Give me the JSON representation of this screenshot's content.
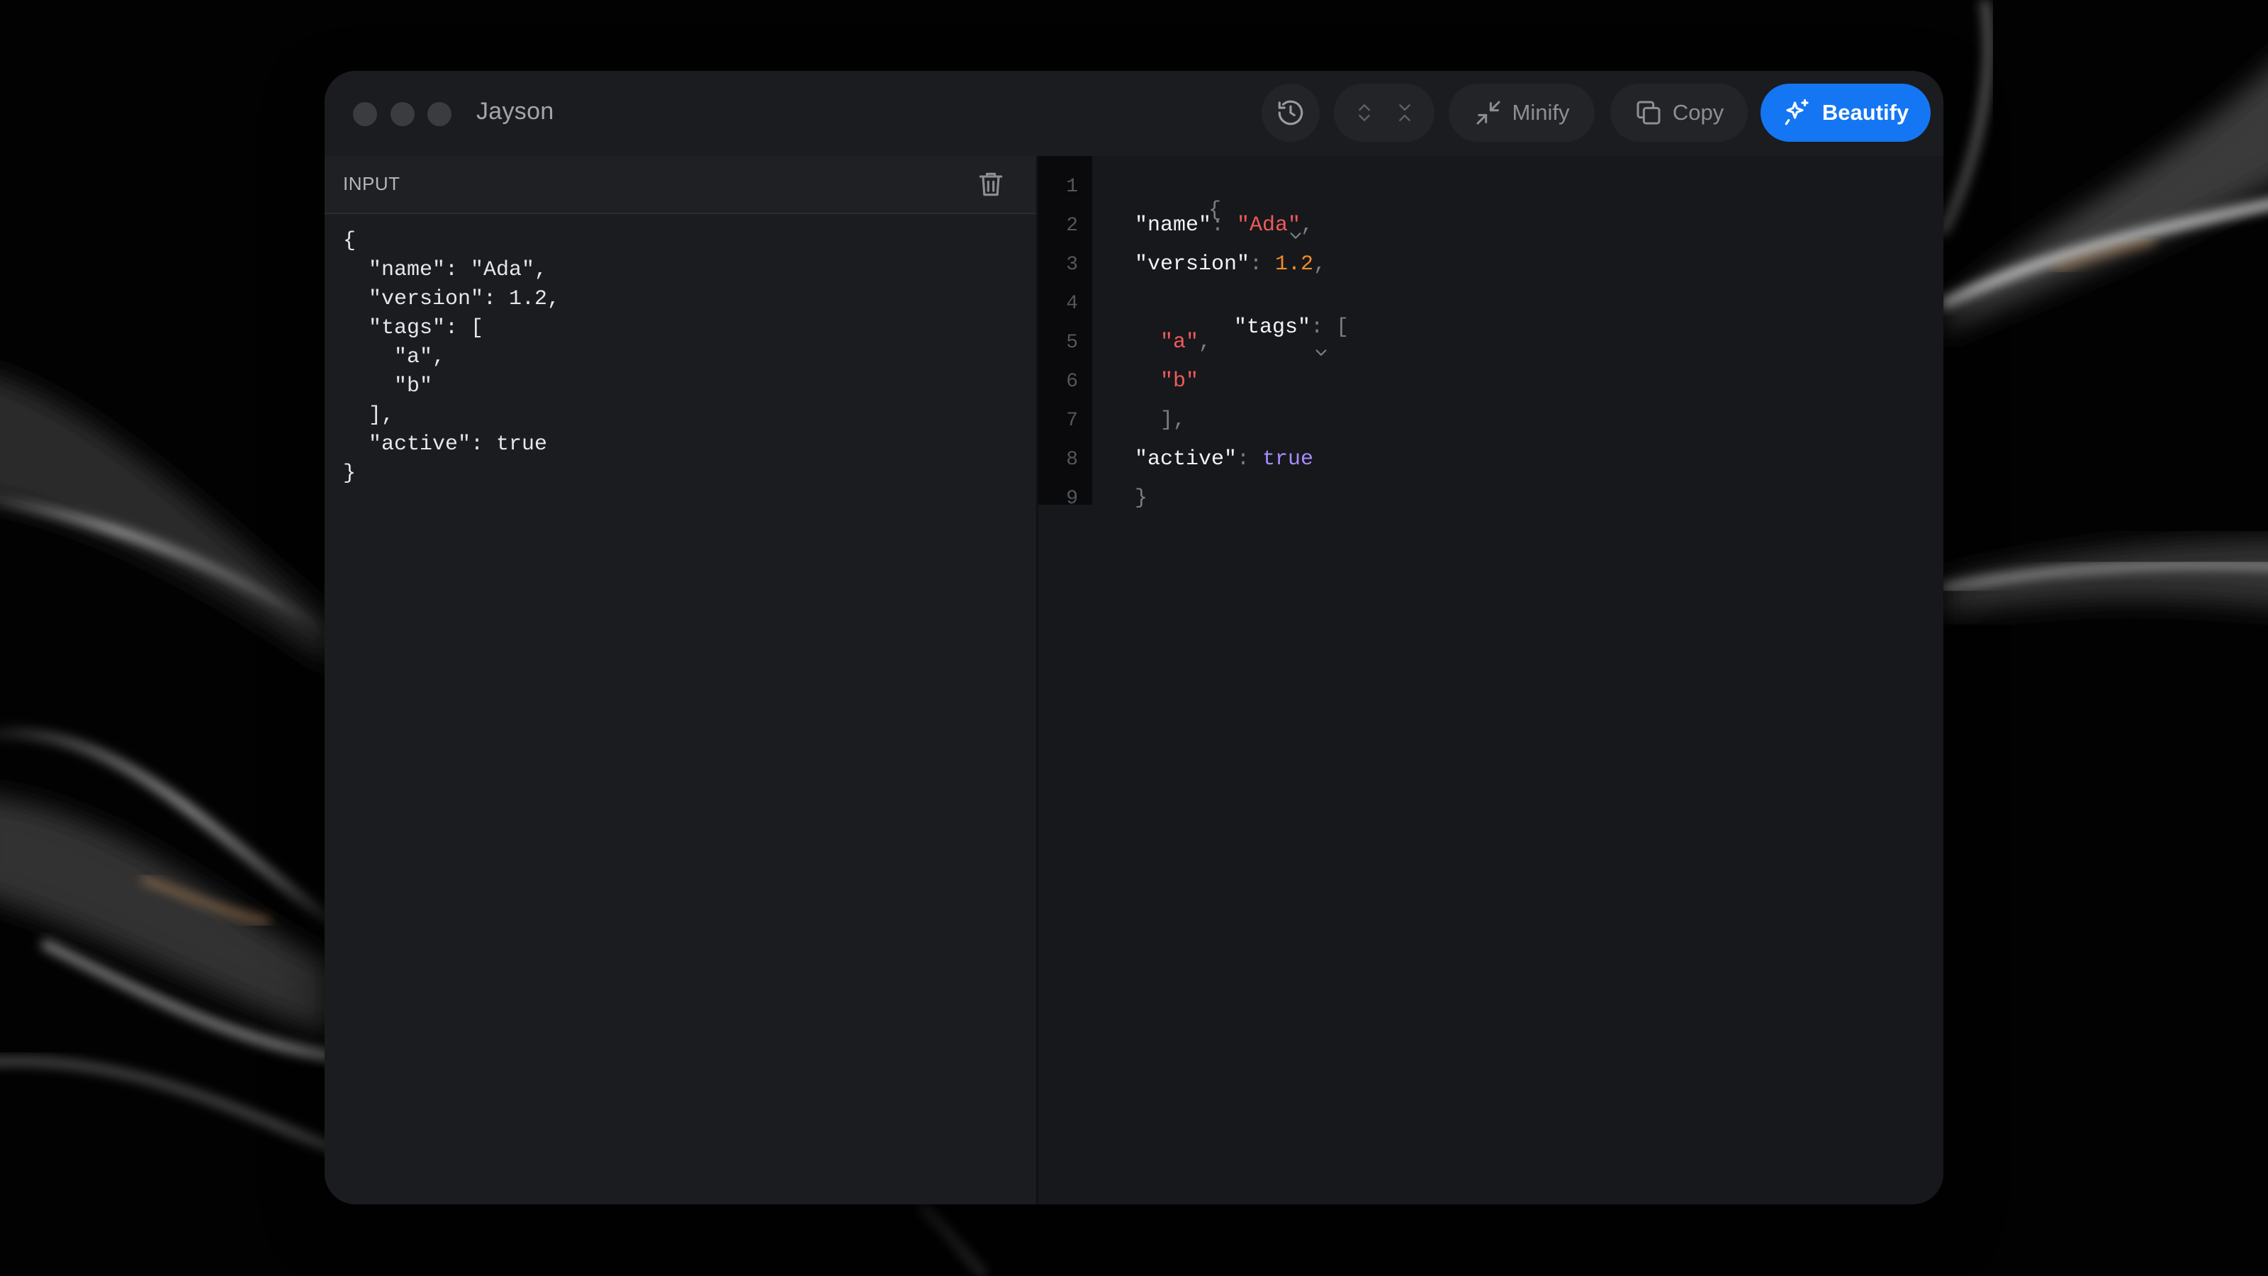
{
  "app": {
    "title": "Jayson"
  },
  "toolbar": {
    "history_icon": "history-icon",
    "expand_icon": "chevrons-expand-icon",
    "collapse_icon": "chevrons-collapse-icon",
    "minify_label": "Minify",
    "copy_label": "Copy",
    "beautify_label": "Beautify",
    "accent_color": "#1476f2"
  },
  "input": {
    "label": "INPUT",
    "text": "{\n  \"name\": \"Ada\",\n  \"version\": 1.2,\n  \"tags\": [\n    \"a\",\n    \"b\"\n  ],\n  \"active\": true\n}"
  },
  "output": {
    "line_numbers": [
      "1",
      "2",
      "3",
      "4",
      "5",
      "6",
      "7",
      "8",
      "9"
    ],
    "lines": {
      "l1": {
        "open": "{"
      },
      "l2": {
        "key": "\"name\"",
        "colon": ": ",
        "value": "\"Ada\"",
        "comma": ","
      },
      "l3": {
        "key": "\"version\"",
        "colon": ": ",
        "value": "1.2",
        "comma": ","
      },
      "l4": {
        "key": "\"tags\"",
        "colon": ": ",
        "open": "["
      },
      "l5": {
        "value": "\"a\"",
        "comma": ","
      },
      "l6": {
        "value": "\"b\""
      },
      "l7": {
        "close": "],"
      },
      "l8": {
        "key": "\"active\"",
        "colon": ": ",
        "value": "true"
      },
      "l9": {
        "close": "}"
      }
    },
    "colors": {
      "string": "#f05a5a",
      "number": "#f08c2a",
      "boolean": "#a78bfa",
      "key": "#f2f2f4",
      "punctuation": "#7c7d82"
    }
  }
}
